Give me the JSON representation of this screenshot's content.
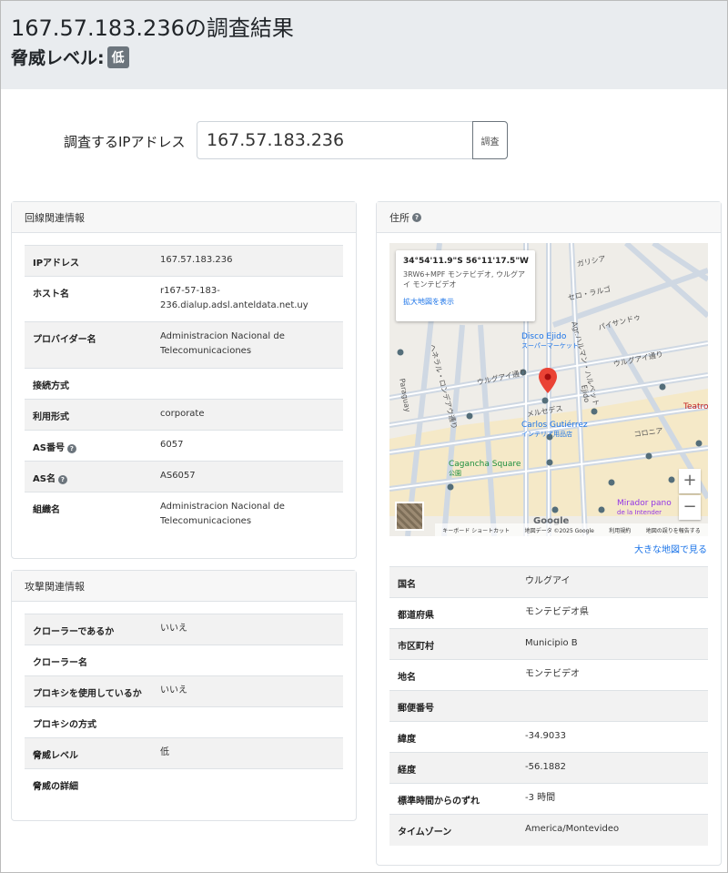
{
  "header": {
    "title": "167.57.183.236の調査結果",
    "threat_label": "脅威レベル:",
    "threat_badge": "低"
  },
  "search": {
    "label": "調査するIPアドレス",
    "value": "167.57.183.236",
    "button": "調査"
  },
  "line_info": {
    "title": "回線関連情報",
    "rows": [
      {
        "key": "IPアドレス",
        "value": "167.57.183.236",
        "help": false
      },
      {
        "key": "ホスト名",
        "value": "r167-57-183-\n236.dialup.adsl.anteldata.net.uy",
        "help": false
      },
      {
        "key": "プロバイダー名",
        "value": "Administracion Nacional de\nTelecomunicaciones",
        "help": false
      },
      {
        "key": "接続方式",
        "value": "",
        "help": false
      },
      {
        "key": "利用形式",
        "value": "corporate",
        "help": false
      },
      {
        "key": "AS番号",
        "value": "6057",
        "help": true
      },
      {
        "key": "AS名",
        "value": "AS6057",
        "help": true
      },
      {
        "key": "組織名",
        "value": "Administracion Nacional de\nTelecomunicaciones",
        "help": false
      }
    ]
  },
  "attack_info": {
    "title": "攻撃関連情報",
    "rows": [
      {
        "key": "クローラーであるか",
        "value": "いいえ"
      },
      {
        "key": "クローラー名",
        "value": ""
      },
      {
        "key": "プロキシを使用しているか",
        "value": "いいえ"
      },
      {
        "key": "プロキシの方式",
        "value": ""
      },
      {
        "key": "脅威レベル",
        "value": "低"
      },
      {
        "key": "脅威の詳細",
        "value": ""
      }
    ]
  },
  "address": {
    "title": "住所",
    "map": {
      "coords": "34°54'11.9\"S 56°11'17.5\"W",
      "plus_code": "3RW6+MPF モンテビデオ, ウルグアイ モンテビデオ",
      "enlarge_link": "拡大地図を表示",
      "streets": [
        "ウルグアイ通り",
        "メルセデス",
        "セロ・ラルゴ",
        "ガリシア",
        "パイサンドゥ",
        "ヘネラル・ロンデアウ通り",
        "ウルグアイ通り",
        "Paraguay",
        "Ejido",
        "コロニア",
        "Agr.ハルマン・ハルベット"
      ],
      "places": [
        {
          "name": "Disco Ejido",
          "sub": "スーパーマーケット",
          "color": "#1a73e8"
        },
        {
          "name": "Carlos Gutiérrez",
          "sub": "インテリア用品店",
          "color": "#1a73e8"
        },
        {
          "name": "Cagancha Square",
          "sub": "公園",
          "color": "#1e8e3e"
        },
        {
          "name": "Mirador pano",
          "sub": "de la Intender",
          "color": "#9334e6"
        },
        {
          "name": "Teatro",
          "sub": "",
          "color": "#c5221f"
        }
      ],
      "attribution": {
        "shortcuts": "キーボード ショートカット",
        "data": "地図データ ©2025 Google",
        "terms": "利用規約",
        "report": "地図の誤りを報告する"
      },
      "google": "Google"
    },
    "larger_map": "大きな地図で見る",
    "rows": [
      {
        "key": "国名",
        "value": "ウルグアイ"
      },
      {
        "key": "都道府県",
        "value": "モンテビデオ県"
      },
      {
        "key": "市区町村",
        "value": "Municipio B"
      },
      {
        "key": "地名",
        "value": "モンテビデオ"
      },
      {
        "key": "郵便番号",
        "value": ""
      },
      {
        "key": "緯度",
        "value": "-34.9033"
      },
      {
        "key": "経度",
        "value": "-56.1882"
      },
      {
        "key": "標準時間からのずれ",
        "value": "-3 時間"
      },
      {
        "key": "タイムゾーン",
        "value": "America/Montevideo"
      }
    ]
  }
}
